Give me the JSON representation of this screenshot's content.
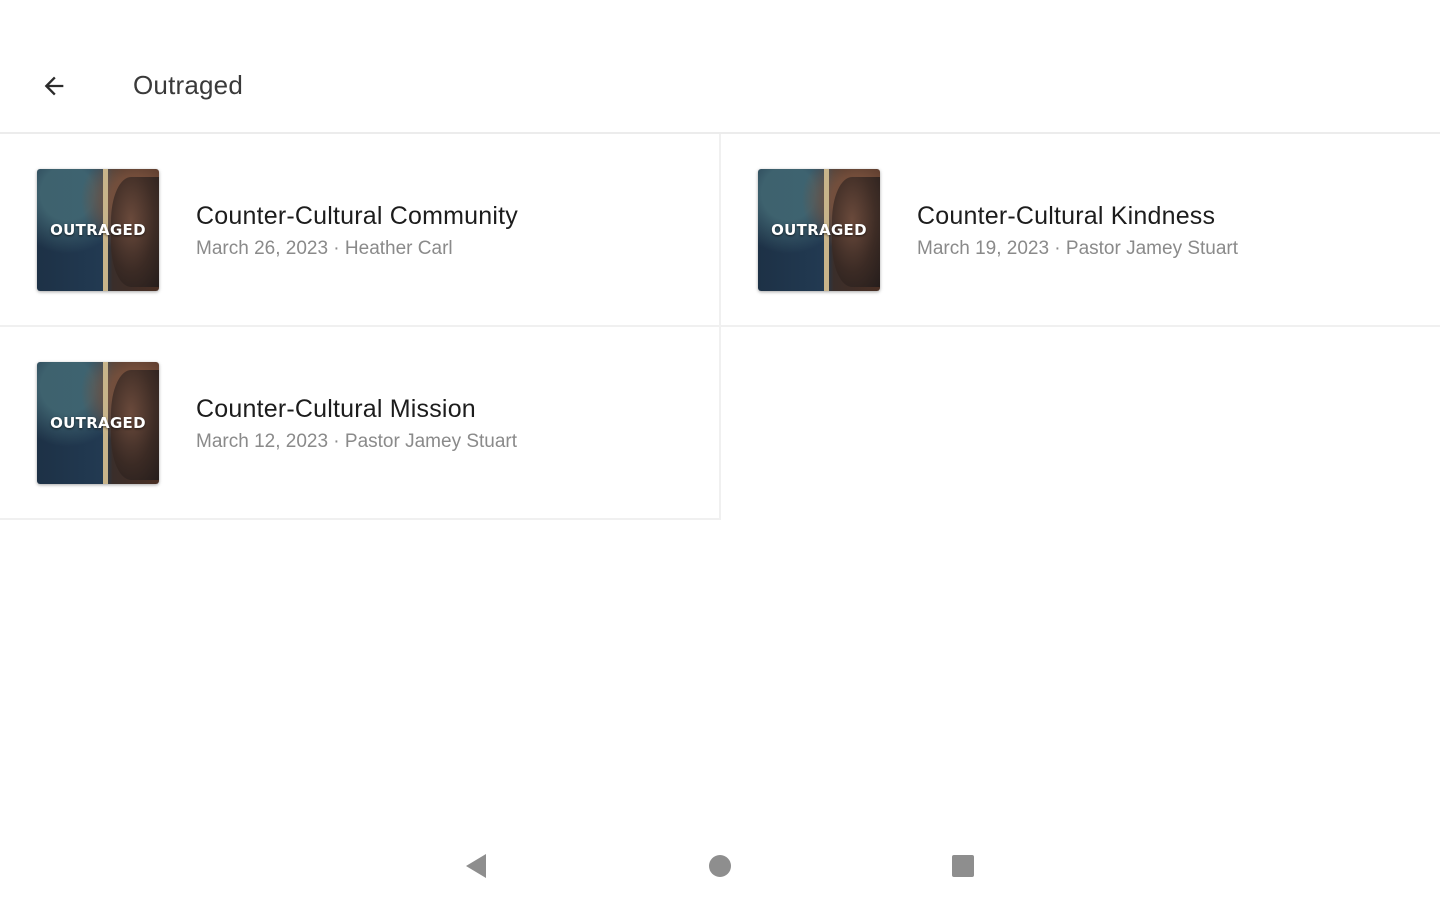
{
  "header": {
    "back_icon": "arrow-left-icon",
    "title": "Outraged"
  },
  "sermons": [
    {
      "title": "Counter-Cultural Community",
      "meta": "March 26, 2023 · Heather Carl",
      "thumbnail_text": "OUTRAGED"
    },
    {
      "title": "Counter-Cultural Kindness",
      "meta": "March 19, 2023 · Pastor Jamey Stuart",
      "thumbnail_text": "OUTRAGED"
    },
    {
      "title": "Counter-Cultural Mission",
      "meta": "March 12, 2023 · Pastor Jamey Stuart",
      "thumbnail_text": "OUTRAGED"
    }
  ],
  "system_nav": {
    "back_icon": "nav-back-triangle-icon",
    "home_icon": "nav-home-circle-icon",
    "recents_icon": "nav-recents-square-icon",
    "icon_color": "#8e8e8e"
  }
}
